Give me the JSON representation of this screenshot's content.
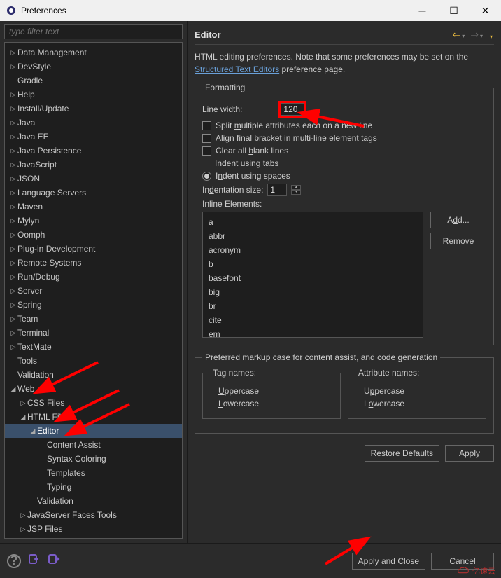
{
  "window": {
    "title": "Preferences"
  },
  "filter": {
    "placeholder": "type filter text"
  },
  "tree": [
    {
      "label": "Data Management",
      "depth": 0,
      "tw": "closed"
    },
    {
      "label": "DevStyle",
      "depth": 0,
      "tw": "closed"
    },
    {
      "label": "Gradle",
      "depth": 0,
      "tw": "none"
    },
    {
      "label": "Help",
      "depth": 0,
      "tw": "closed"
    },
    {
      "label": "Install/Update",
      "depth": 0,
      "tw": "closed"
    },
    {
      "label": "Java",
      "depth": 0,
      "tw": "closed"
    },
    {
      "label": "Java EE",
      "depth": 0,
      "tw": "closed"
    },
    {
      "label": "Java Persistence",
      "depth": 0,
      "tw": "closed"
    },
    {
      "label": "JavaScript",
      "depth": 0,
      "tw": "closed"
    },
    {
      "label": "JSON",
      "depth": 0,
      "tw": "closed"
    },
    {
      "label": "Language Servers",
      "depth": 0,
      "tw": "closed"
    },
    {
      "label": "Maven",
      "depth": 0,
      "tw": "closed"
    },
    {
      "label": "Mylyn",
      "depth": 0,
      "tw": "closed"
    },
    {
      "label": "Oomph",
      "depth": 0,
      "tw": "closed"
    },
    {
      "label": "Plug-in Development",
      "depth": 0,
      "tw": "closed"
    },
    {
      "label": "Remote Systems",
      "depth": 0,
      "tw": "closed"
    },
    {
      "label": "Run/Debug",
      "depth": 0,
      "tw": "closed"
    },
    {
      "label": "Server",
      "depth": 0,
      "tw": "closed"
    },
    {
      "label": "Spring",
      "depth": 0,
      "tw": "closed"
    },
    {
      "label": "Team",
      "depth": 0,
      "tw": "closed"
    },
    {
      "label": "Terminal",
      "depth": 0,
      "tw": "closed"
    },
    {
      "label": "TextMate",
      "depth": 0,
      "tw": "closed"
    },
    {
      "label": "Tools",
      "depth": 0,
      "tw": "none"
    },
    {
      "label": "Validation",
      "depth": 0,
      "tw": "none"
    },
    {
      "label": "Web",
      "depth": 0,
      "tw": "open"
    },
    {
      "label": "CSS Files",
      "depth": 1,
      "tw": "closed"
    },
    {
      "label": "HTML Files",
      "depth": 1,
      "tw": "open"
    },
    {
      "label": "Editor",
      "depth": 2,
      "tw": "open",
      "selected": true
    },
    {
      "label": "Content Assist",
      "depth": 3,
      "tw": "none"
    },
    {
      "label": "Syntax Coloring",
      "depth": 3,
      "tw": "none"
    },
    {
      "label": "Templates",
      "depth": 3,
      "tw": "none"
    },
    {
      "label": "Typing",
      "depth": 3,
      "tw": "none"
    },
    {
      "label": "Validation",
      "depth": 2,
      "tw": "none"
    },
    {
      "label": "JavaServer Faces Tools",
      "depth": 1,
      "tw": "closed"
    },
    {
      "label": "JSP Files",
      "depth": 1,
      "tw": "closed"
    }
  ],
  "main": {
    "title": "Editor",
    "intro_pre": "HTML editing preferences.  Note that some preferences may be set on the ",
    "intro_link": "Structured Text Editors",
    "intro_post": " preference page."
  },
  "formatting": {
    "legend": "Formatting",
    "line_width_label": "Line width:",
    "line_width_value": "120",
    "split_label": "Split multiple attributes each on a new line",
    "align_label": "Align final bracket in multi-line element tags",
    "clear_label": "Clear all blank lines",
    "indent_tabs": "Indent using tabs",
    "indent_spaces": "Indent using spaces",
    "indent_size_label": "Indentation size:",
    "indent_size_value": "1",
    "inline_label": "Inline Elements:",
    "inline_items": [
      "a",
      "abbr",
      "acronym",
      "b",
      "basefont",
      "big",
      "br",
      "cite",
      "em"
    ],
    "add_btn": "Add...",
    "remove_btn": "Remove"
  },
  "case": {
    "legend": "Preferred markup case for content assist, and code generation",
    "tag_legend": "Tag names:",
    "attr_legend": "Attribute names:",
    "upper": "Uppercase",
    "lower": "Lowercase"
  },
  "buttons": {
    "restore": "Restore Defaults",
    "apply": "Apply",
    "apply_close": "Apply and Close",
    "cancel": "Cancel"
  },
  "watermark": "亿速云"
}
